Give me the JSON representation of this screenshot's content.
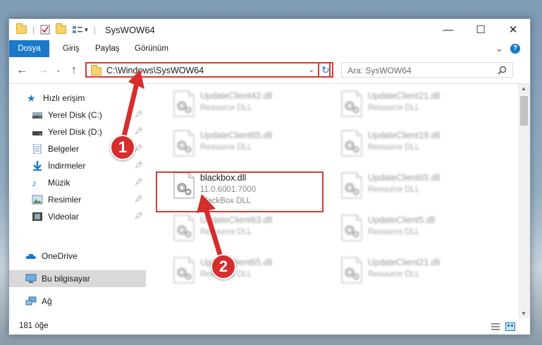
{
  "window": {
    "title": "SysWOW64",
    "minimize_glyph": "—",
    "maximize_glyph": "☐",
    "close_glyph": "✕"
  },
  "ribbon": {
    "tabs": [
      "Dosya",
      "Giriş",
      "Paylaş",
      "Görünüm"
    ],
    "expand_glyph": "⌄",
    "help_glyph": "?"
  },
  "nav": {
    "address": "C:\\Windows\\SysWOW64",
    "search_placeholder": "Ara: SysWOW64"
  },
  "sidebar": {
    "items": [
      {
        "label": "Hızlı erişim",
        "icon": "star-icon",
        "pinned": false
      },
      {
        "label": "Yerel Disk (C:)",
        "icon": "drive-icon",
        "pinned": true
      },
      {
        "label": "Yerel Disk (D:)",
        "icon": "drive-icon",
        "pinned": true
      },
      {
        "label": "Belgeler",
        "icon": "documents-icon",
        "pinned": true
      },
      {
        "label": "İndirmeler",
        "icon": "download-icon",
        "pinned": true
      },
      {
        "label": "Müzik",
        "icon": "music-icon",
        "pinned": true
      },
      {
        "label": "Resimler",
        "icon": "pictures-icon",
        "pinned": true
      },
      {
        "label": "Videolar",
        "icon": "videos-icon",
        "pinned": true
      },
      {
        "label": "OneDrive",
        "icon": "onedrive-icon",
        "pinned": false
      },
      {
        "label": "Bu bilgisayar",
        "icon": "computer-icon",
        "pinned": false,
        "selected": true
      },
      {
        "label": "Ağ",
        "icon": "network-icon",
        "pinned": false
      }
    ]
  },
  "files": [
    {
      "name": "UpdateClient42.dll",
      "type": "Resource DLL"
    },
    {
      "name": "UpdateClient21.dll",
      "type": "Resource DLL"
    },
    {
      "name": "UpdateClient65.dll",
      "type": "Resource DLL"
    },
    {
      "name": "UpdateClient19.dll",
      "type": "Resource DLL"
    },
    {
      "name": "blackbox.dll",
      "version": "11.0.6001.7000",
      "type": "BlackBox DLL",
      "highlighted": true
    },
    {
      "name": "UpdateClient65.dll",
      "type": "Resource DLL"
    },
    {
      "name": "UpdateClient63.dll",
      "type": "Resource DLL"
    },
    {
      "name": "UpdateClient5.dll",
      "type": "Resource DLL"
    },
    {
      "name": "UpdateClient65.dll",
      "type": "Resource DLL"
    },
    {
      "name": "UpdateClient21.dll",
      "type": "Resource DLL"
    }
  ],
  "status": {
    "item_count": "181 öğe"
  },
  "callouts": [
    "1",
    "2"
  ],
  "colors": {
    "accent": "#1979ca",
    "highlight": "#d73a35",
    "folder": "#f6d36f"
  }
}
